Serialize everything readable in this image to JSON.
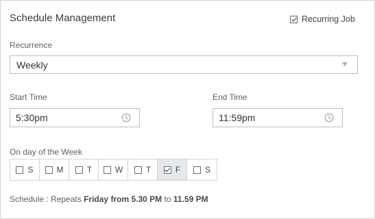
{
  "panel": {
    "title": "Schedule Management",
    "recurring_label": "Recurring Job",
    "recurring_checked": true
  },
  "recurrence": {
    "label": "Recurrence",
    "value": "Weekly",
    "icon": "chevron-down-icon"
  },
  "start_time": {
    "label": "Start Time",
    "value": "5:30pm",
    "icon": "clock-icon"
  },
  "end_time": {
    "label": "End Time",
    "value": "11:59pm",
    "icon": "clock-icon"
  },
  "week": {
    "label": "On day of the Week",
    "days": [
      {
        "letter": "S",
        "checked": false
      },
      {
        "letter": "M",
        "checked": false
      },
      {
        "letter": "T",
        "checked": false
      },
      {
        "letter": "W",
        "checked": false
      },
      {
        "letter": "T",
        "checked": false
      },
      {
        "letter": "F",
        "checked": true
      },
      {
        "letter": "S",
        "checked": false
      }
    ]
  },
  "schedule": {
    "prefix": "Schedule : Repeats",
    "day": "Friday",
    "from_word": "from",
    "start": "5.30 PM",
    "to_word": "to",
    "end": "11.59 PM"
  },
  "colors": {
    "border": "#cfd3d6",
    "selected_day_bg": "#e6e9eb",
    "label_text": "#5a6168"
  }
}
